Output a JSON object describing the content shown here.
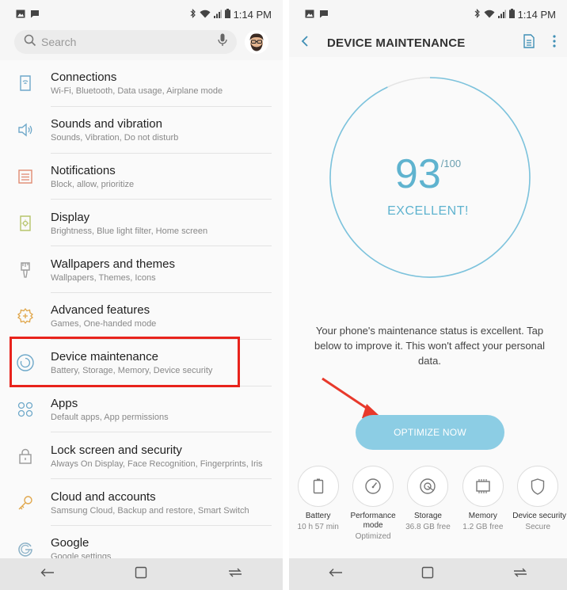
{
  "status_bar": {
    "time": "1:14 PM"
  },
  "search": {
    "placeholder": "Search"
  },
  "settings": [
    {
      "title": "Connections",
      "subtitle": "Wi-Fi, Bluetooth, Data usage, Airplane mode",
      "icon": "connections-icon"
    },
    {
      "title": "Sounds and vibration",
      "subtitle": "Sounds, Vibration, Do not disturb",
      "icon": "speaker-icon"
    },
    {
      "title": "Notifications",
      "subtitle": "Block, allow, prioritize",
      "icon": "notifications-icon"
    },
    {
      "title": "Display",
      "subtitle": "Brightness, Blue light filter, Home screen",
      "icon": "display-icon"
    },
    {
      "title": "Wallpapers and themes",
      "subtitle": "Wallpapers, Themes, Icons",
      "icon": "brush-icon"
    },
    {
      "title": "Advanced features",
      "subtitle": "Games, One-handed mode",
      "icon": "gear-plus-icon"
    },
    {
      "title": "Device maintenance",
      "subtitle": "Battery, Storage, Memory, Device security",
      "icon": "maintenance-icon"
    },
    {
      "title": "Apps",
      "subtitle": "Default apps, App permissions",
      "icon": "apps-grid-icon"
    },
    {
      "title": "Lock screen and security",
      "subtitle": "Always On Display, Face Recognition, Fingerprints, Iris",
      "icon": "lock-icon"
    },
    {
      "title": "Cloud and accounts",
      "subtitle": "Samsung Cloud, Backup and restore, Smart Switch",
      "icon": "key-icon"
    },
    {
      "title": "Google",
      "subtitle": "Google settings",
      "icon": "google-icon"
    }
  ],
  "device_maintenance": {
    "title": "DEVICE MAINTENANCE",
    "score": "93",
    "score_max": "/100",
    "score_fraction": 0.93,
    "verdict": "EXCELLENT!",
    "description": "Your phone's maintenance status is excellent. Tap below to improve it. This won't affect your personal data.",
    "optimize_label": "OPTIMIZE NOW",
    "tiles": [
      {
        "label": "Battery",
        "value": "10 h 57 min",
        "icon": "battery-icon"
      },
      {
        "label": "Performance mode",
        "value": "Optimized",
        "icon": "speedometer-icon"
      },
      {
        "label": "Storage",
        "value": "36.8 GB free",
        "icon": "storage-icon"
      },
      {
        "label": "Memory",
        "value": "1.2 GB free",
        "icon": "memory-chip-icon"
      },
      {
        "label": "Device security",
        "value": "Secure",
        "icon": "shield-icon"
      }
    ]
  },
  "colors": {
    "accent": "#5fb3cf",
    "highlight": "#e8231c",
    "arrow": "#e8392b",
    "button": "#8ccde4"
  }
}
